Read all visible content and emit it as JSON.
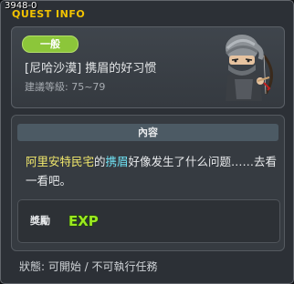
{
  "window": {
    "id": "3948-0",
    "title": "QUEST INFO"
  },
  "quest": {
    "badge": "一般",
    "name": "[尼哈沙漠] 携眉的好习惯",
    "level": "建議等級: 75~79",
    "npc_icon": "masked-ninja-npc"
  },
  "content": {
    "header": "內容",
    "description_parts": {
      "place": "阿里安特民宅",
      "connector": "的",
      "npc": "携眉",
      "text": "好像发生了什么问题……去看一看吧。"
    },
    "reward_label": "獎勵",
    "reward_icon": "exp-icon",
    "reward_text": "EXP"
  },
  "status": "狀態: 可開始 / 不可執行任務",
  "colors": {
    "title": "#f2c300",
    "badge": "#8cc63a",
    "highlight_place": "#f2e96c",
    "highlight_npc": "#6fe0f2",
    "exp_fill": "#9be81f"
  }
}
